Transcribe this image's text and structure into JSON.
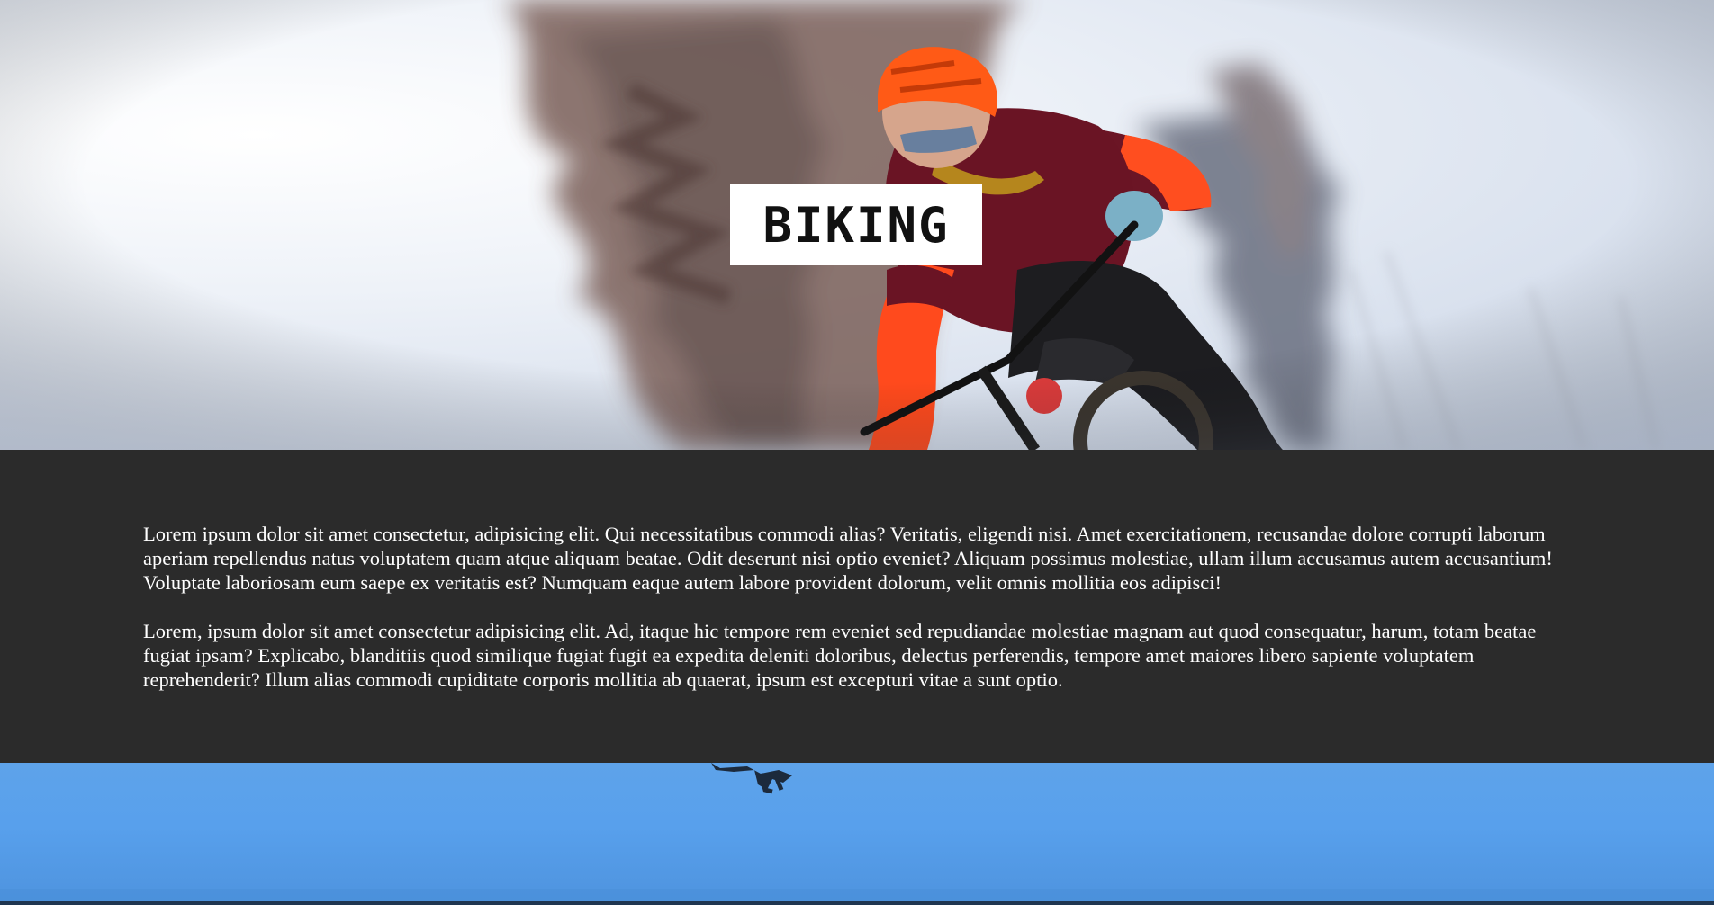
{
  "hero": {
    "title": "BIKING"
  },
  "content": {
    "paragraphs": [
      "Lorem ipsum dolor sit amet consectetur, adipisicing elit. Qui necessitatibus commodi alias? Veritatis, eligendi nisi. Amet exercitationem, recusandae dolore corrupti laborum aperiam repellendus natus voluptatem quam atque aliquam beatae. Odit deserunt nisi optio eveniet? Aliquam possimus molestiae, ullam illum accusamus autem accusantium! Voluptate laboriosam eum saepe ex veritatis est? Numquam eaque autem labore provident dolorum, velit omnis mollitia eos adipisci!",
      "Lorem, ipsum dolor sit amet consectetur adipisicing elit. Ad, itaque hic tempore rem eveniet sed repudiandae molestiae magnam aut quod consequatur, harum, totam beatae fugiat ipsam? Explicabo, blanditiis quod similique fugiat fugit ea expedita deleniti doloribus, delectus perferendis, tempore amet maiores libero sapiente voluptatem reprehenderit? Illum alias commodi cupiditate corporis mollitia ab quaerat, ipsum est excepturi vitae a sunt optio."
    ]
  },
  "colors": {
    "content_background": "#2b2b2b",
    "content_text": "#ffffff",
    "title_box_background": "#ffffff",
    "title_text": "#111111",
    "sky_blue": "#5ea3ea"
  }
}
